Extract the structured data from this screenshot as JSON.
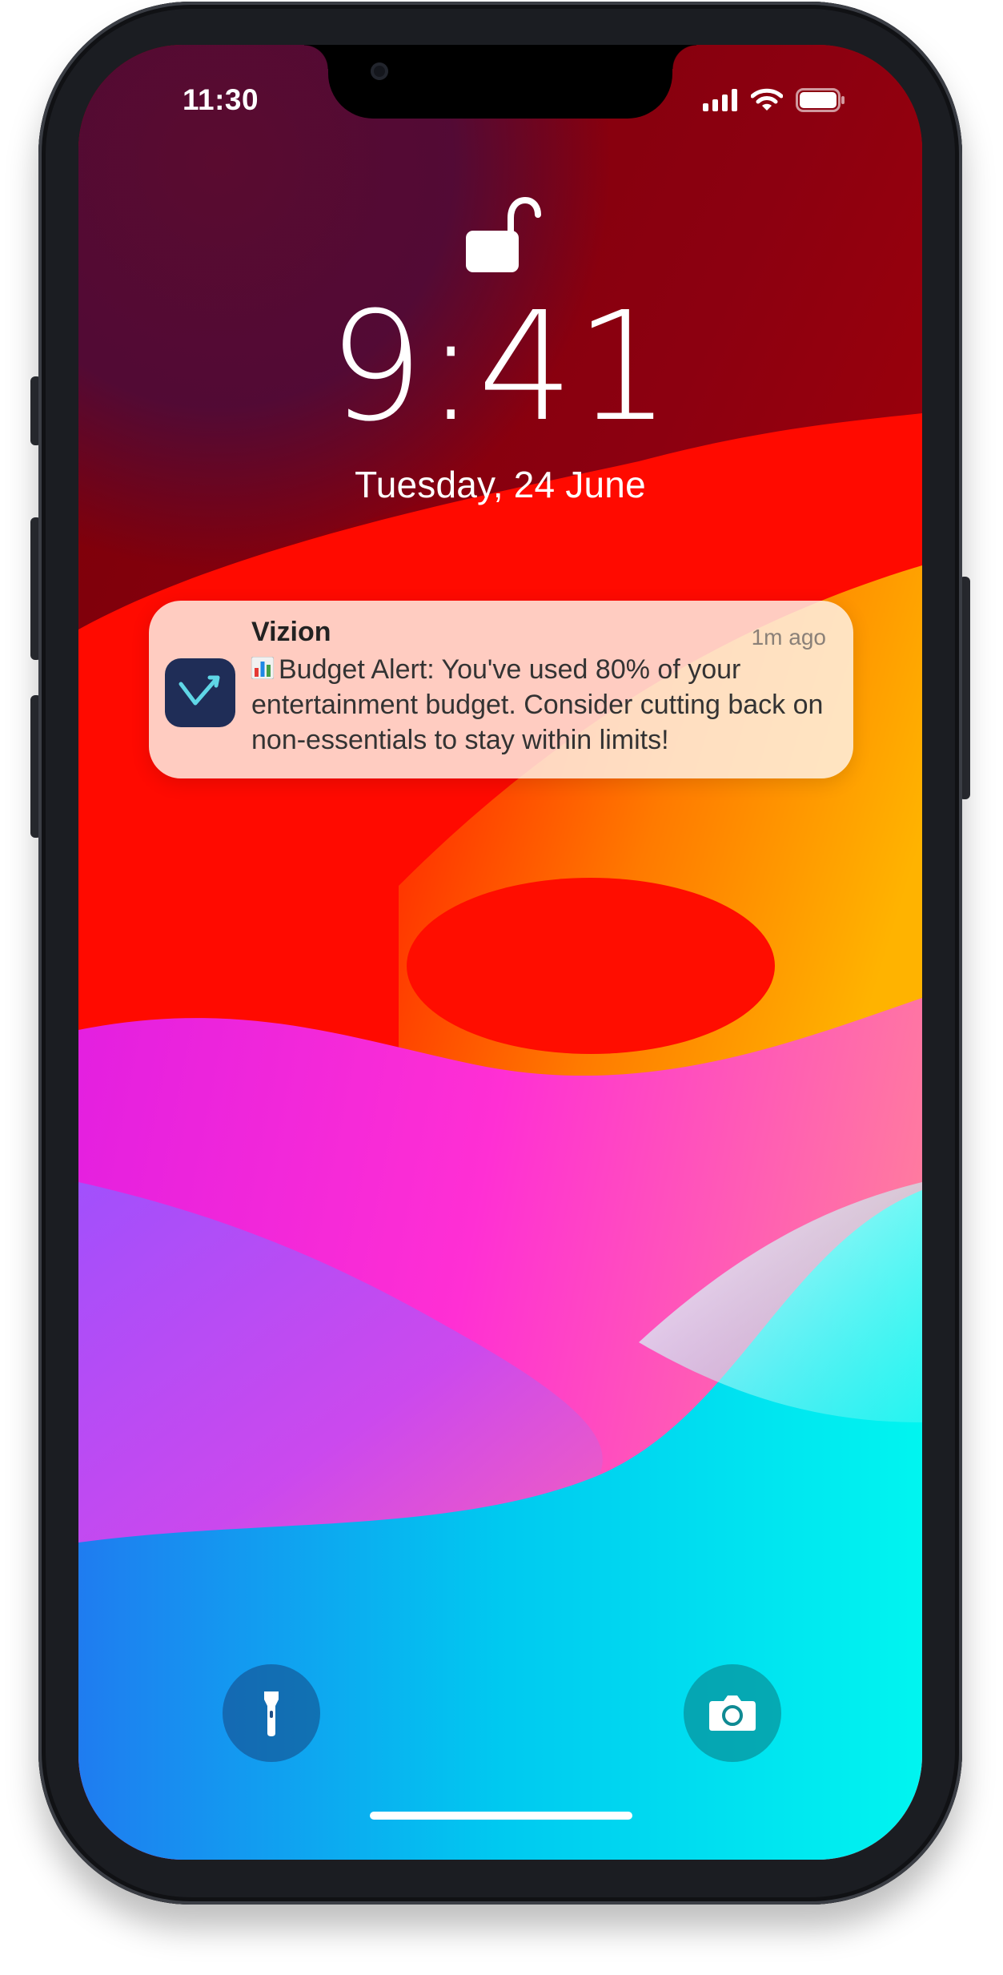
{
  "status_bar": {
    "time": "11:30",
    "icons": [
      "signal-icon",
      "wifi-icon",
      "battery-icon"
    ]
  },
  "lock_screen": {
    "lock_icon": "unlocked-padlock-icon",
    "clock": "9:41",
    "date": "Tuesday, 24 June"
  },
  "notification": {
    "app_name": "Vizion",
    "time_ago": "1m ago",
    "emoji_icon": "bar-chart-icon",
    "message": "Budget Alert: You've used 80% of your entertainment budget. Consider cutting back on non-essentials to stay within limits!",
    "app_icon": "vizion-trend-icon",
    "app_icon_color": "#1f2d57",
    "accent_color": "#5fd6e6"
  },
  "quick_actions": {
    "left": "flashlight-icon",
    "right": "camera-icon"
  }
}
